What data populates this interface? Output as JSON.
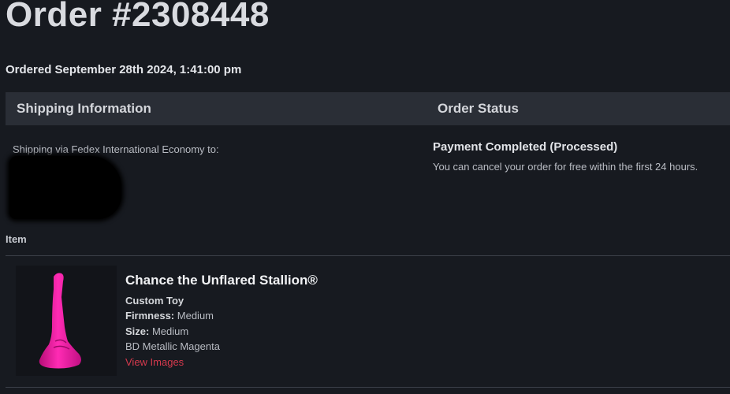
{
  "order": {
    "title": "Order #2308448",
    "ordered_date": "Ordered September 28th 2024, 1:41:00 pm"
  },
  "headers": {
    "shipping": "Shipping Information",
    "status": "Order Status"
  },
  "shipping": {
    "via_text": "Shipping via Fedex International Economy to:"
  },
  "status": {
    "title": "Payment Completed (Processed)",
    "note": "You can cancel your order for free within the first 24 hours."
  },
  "items": {
    "heading": "Item",
    "product": {
      "name": "Chance the Unflared Stallion®",
      "type": "Custom Toy",
      "firmness_label": "Firmness:",
      "firmness_value": "Medium",
      "size_label": "Size:",
      "size_value": "Medium",
      "color": "BD Metallic Magenta",
      "view_images_label": "View Images",
      "image_color": "#ff1aa8"
    }
  },
  "colors": {
    "background": "#171a20",
    "header_bar": "#2a2e36",
    "link": "#d6394d"
  }
}
